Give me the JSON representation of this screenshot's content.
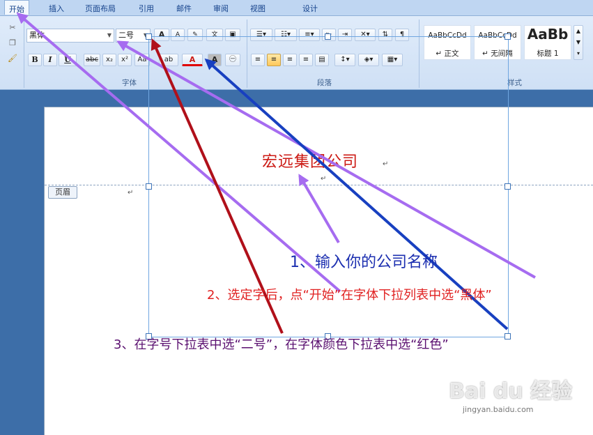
{
  "ribbon": {
    "tabs": [
      "开始",
      "插入",
      "页面布局",
      "引用",
      "邮件",
      "审阅",
      "视图",
      "设计"
    ],
    "font_name": "黑体",
    "font_size": "二号",
    "groups": {
      "font": "字体",
      "paragraph": "段落",
      "styles": "样式"
    },
    "styles": [
      {
        "sample": "AaBbCcDd",
        "name": "↵ 正文"
      },
      {
        "sample": "AaBbCcDd",
        "name": "↵ 无间隔"
      },
      {
        "sample": "AaBb",
        "name": "标题 1"
      }
    ],
    "buttons": {
      "bold": "B",
      "italic": "I",
      "underline": "U",
      "strike": "abc",
      "sub": "x₂",
      "sup": "x²",
      "aa": "Aa",
      "font_color": "A",
      "shade": "A",
      "grow": "A",
      "shrink": "A"
    }
  },
  "document": {
    "company_name": "宏远集团公司",
    "header_tag": "页眉",
    "return_mark": "↵"
  },
  "annotations": [
    {
      "text": "1、输入你的公司名称",
      "color": "#1c2fb0"
    },
    {
      "text": "2、选定字后，点“开始”在字体下拉列表中选“黑体”",
      "color": "#e02020"
    },
    {
      "text": "3、在字号下拉表中选“二号”，在字体颜色下拉表中选“红色”",
      "color": "#5a1070"
    }
  ],
  "colors": {
    "purple_arrow": "#a66cf0",
    "red_arrow": "#b0101a",
    "blue_arrow": "#1840c0",
    "font_red": "#cc1a14"
  },
  "watermark": {
    "logo": "Bai du 经验",
    "site": "jingyan.baidu.com"
  }
}
